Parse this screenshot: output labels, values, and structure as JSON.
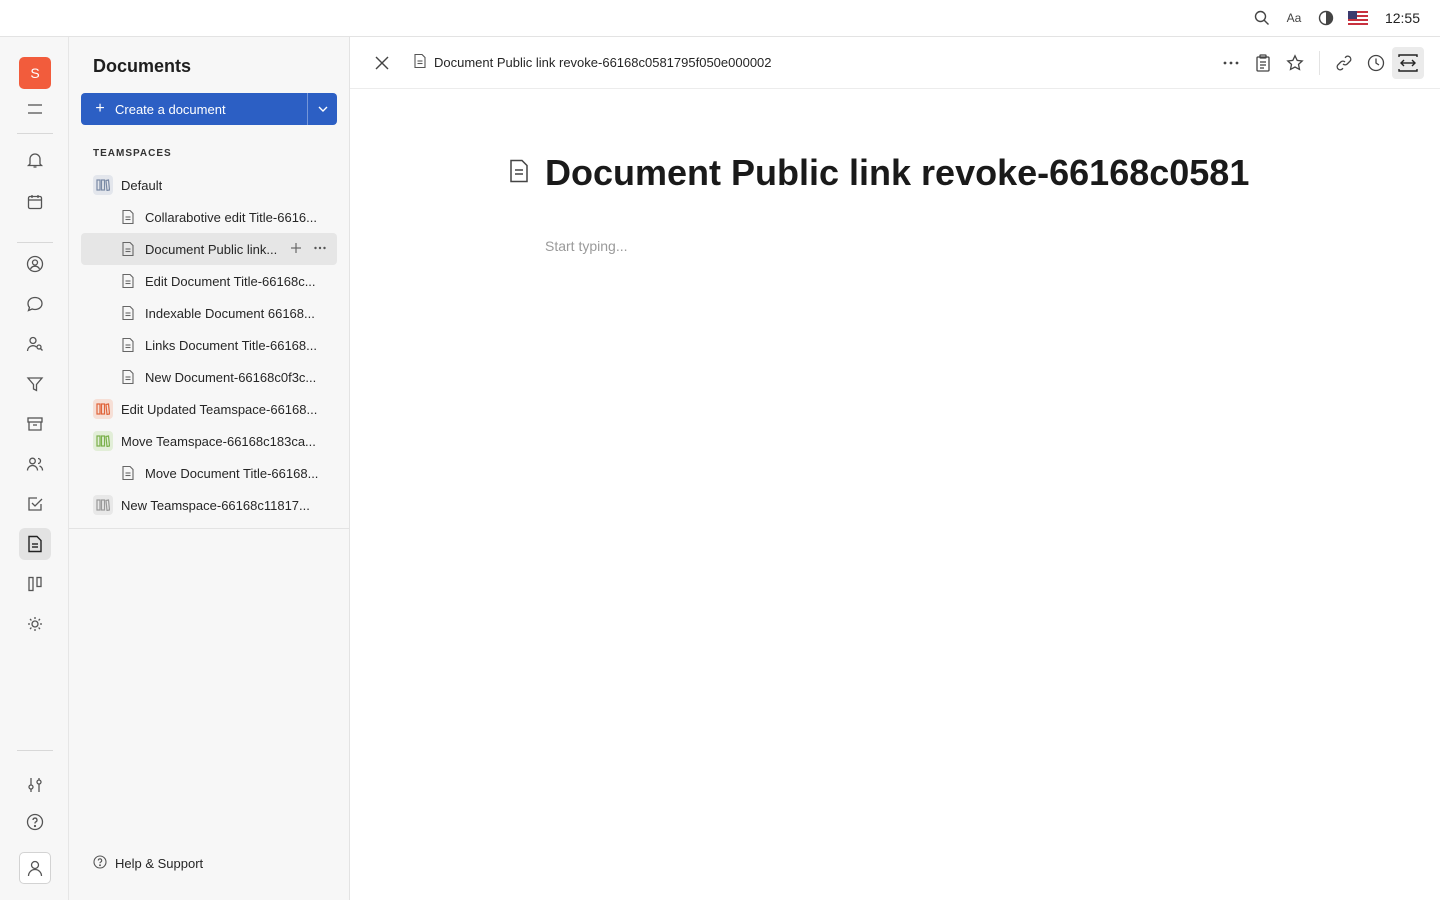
{
  "topbar": {
    "time": "12:55",
    "icons": [
      "search-icon",
      "font-size-icon",
      "theme-contrast-icon",
      "us-flag-icon"
    ]
  },
  "rail": {
    "workspace_initial": "S",
    "icons": [
      "menu-icon",
      "bell-icon",
      "calendar-icon",
      "contacts-icon",
      "chat-icon",
      "recruit-icon",
      "funnel-icon",
      "inventory-icon",
      "team-icon",
      "tasks-icon",
      "documents-icon",
      "board-icon",
      "sun-icon",
      "settings-sliders-icon",
      "help-icon",
      "profile-icon"
    ]
  },
  "navigator": {
    "title": "Documents",
    "create_button": "Create a document",
    "section_label": "TEAMSPACES",
    "tree": [
      {
        "type": "teamspace",
        "label": "Default",
        "color": "#7a8aa5"
      },
      {
        "type": "doc",
        "label": "Collarabotive edit Title-6616..."
      },
      {
        "type": "doc",
        "label": "Document Public link...",
        "selected": true
      },
      {
        "type": "doc",
        "label": "Edit Document Title-66168c..."
      },
      {
        "type": "doc",
        "label": "Indexable Document 66168..."
      },
      {
        "type": "doc",
        "label": "Links Document Title-66168..."
      },
      {
        "type": "doc",
        "label": "New Document-66168c0f3c..."
      },
      {
        "type": "teamspace",
        "label": "Edit Updated Teamspace-66168...",
        "color": "#e0643a"
      },
      {
        "type": "teamspace",
        "label": "Move Teamspace-66168c183ca...",
        "color": "#7ab04a"
      },
      {
        "type": "doc",
        "label": "Move Document Title-66168..."
      },
      {
        "type": "teamspace",
        "label": "New Teamspace-66168c11817...",
        "color": "#9a9a9a"
      }
    ],
    "help": "Help & Support"
  },
  "main": {
    "breadcrumb": "Document Public link revoke-66168c0581795f050e000002",
    "title": "Document Public link revoke-66168c0581",
    "placeholder": "Start typing..."
  }
}
